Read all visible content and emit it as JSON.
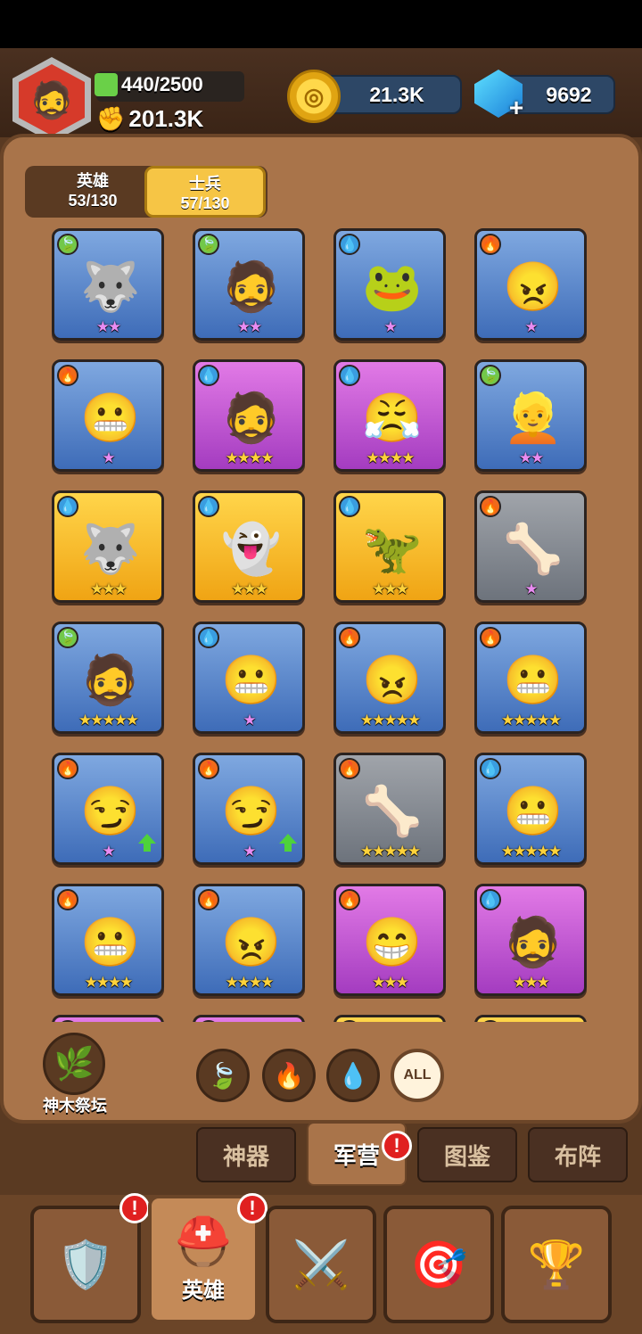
{
  "player": {
    "stamina": "440/2500",
    "power": "201.3K",
    "coins": "21.3K",
    "gems": "9692"
  },
  "toggle": {
    "heroes_label": "英雄",
    "heroes_count": "53/130",
    "soldiers_label": "士兵",
    "soldiers_count": "57/130"
  },
  "cards": [
    {
      "element": "leaf",
      "bg": "blue",
      "stars": 2,
      "star_color": "pink",
      "icon": "🐺",
      "upgrade": false
    },
    {
      "element": "leaf",
      "bg": "blue",
      "stars": 2,
      "star_color": "pink",
      "icon": "🧔",
      "upgrade": false
    },
    {
      "element": "water",
      "bg": "blue",
      "stars": 1,
      "star_color": "pink",
      "icon": "🐸",
      "upgrade": false
    },
    {
      "element": "fire",
      "bg": "blue",
      "stars": 1,
      "star_color": "pink",
      "icon": "😠",
      "upgrade": false
    },
    {
      "element": "fire",
      "bg": "blue",
      "stars": 1,
      "star_color": "pink",
      "icon": "😬",
      "upgrade": false
    },
    {
      "element": "water",
      "bg": "purple",
      "stars": 4,
      "star_color": "gold",
      "icon": "🧔",
      "upgrade": false
    },
    {
      "element": "water",
      "bg": "purple",
      "stars": 4,
      "star_color": "gold",
      "icon": "😤",
      "upgrade": false
    },
    {
      "element": "leaf",
      "bg": "blue",
      "stars": 2,
      "star_color": "pink",
      "icon": "👱",
      "upgrade": false
    },
    {
      "element": "water",
      "bg": "yellow",
      "stars": 3,
      "star_color": "gold",
      "icon": "🐺",
      "upgrade": false
    },
    {
      "element": "water",
      "bg": "yellow",
      "stars": 3,
      "star_color": "gold",
      "icon": "👻",
      "upgrade": false
    },
    {
      "element": "water",
      "bg": "yellow",
      "stars": 3,
      "star_color": "gold",
      "icon": "🦖",
      "upgrade": false
    },
    {
      "element": "fire",
      "bg": "grey",
      "stars": 1,
      "star_color": "pink",
      "icon": "🦴",
      "upgrade": false
    },
    {
      "element": "leaf",
      "bg": "blue",
      "stars": 5,
      "star_color": "gold",
      "icon": "🧔",
      "upgrade": false
    },
    {
      "element": "water",
      "bg": "blue",
      "stars": 1,
      "star_color": "pink",
      "icon": "😬",
      "upgrade": false
    },
    {
      "element": "fire",
      "bg": "blue",
      "stars": 5,
      "star_color": "gold",
      "icon": "😠",
      "upgrade": false
    },
    {
      "element": "fire",
      "bg": "blue",
      "stars": 5,
      "star_color": "gold",
      "icon": "😬",
      "upgrade": false
    },
    {
      "element": "fire",
      "bg": "blue",
      "stars": 1,
      "star_color": "pink",
      "icon": "😏",
      "upgrade": true
    },
    {
      "element": "fire",
      "bg": "blue",
      "stars": 1,
      "star_color": "pink",
      "icon": "😏",
      "upgrade": true
    },
    {
      "element": "fire",
      "bg": "grey",
      "stars": 5,
      "star_color": "gold",
      "icon": "🦴",
      "upgrade": false
    },
    {
      "element": "water",
      "bg": "blue",
      "stars": 5,
      "star_color": "gold",
      "icon": "😬",
      "upgrade": false
    },
    {
      "element": "fire",
      "bg": "blue",
      "stars": 4,
      "star_color": "gold",
      "icon": "😬",
      "upgrade": false
    },
    {
      "element": "fire",
      "bg": "blue",
      "stars": 4,
      "star_color": "gold",
      "icon": "😠",
      "upgrade": false
    },
    {
      "element": "fire",
      "bg": "purple",
      "stars": 3,
      "star_color": "gold",
      "icon": "😁",
      "upgrade": false
    },
    {
      "element": "water",
      "bg": "purple",
      "stars": 3,
      "star_color": "gold",
      "icon": "🧔",
      "upgrade": false
    },
    {
      "element": "leaf",
      "bg": "purple",
      "stars": 0,
      "star_color": "gold",
      "icon": "",
      "upgrade": false
    },
    {
      "element": "fire",
      "bg": "purple",
      "stars": 0,
      "star_color": "gold",
      "icon": "",
      "upgrade": false
    },
    {
      "element": "fire",
      "bg": "yellow",
      "stars": 0,
      "star_color": "gold",
      "icon": "",
      "upgrade": false
    },
    {
      "element": "water",
      "bg": "yellow",
      "stars": 0,
      "star_color": "gold",
      "icon": "",
      "upgrade": false
    }
  ],
  "shrine": {
    "label": "神木祭坛",
    "icon": "tree-icon"
  },
  "filters": {
    "all_label": "ALL"
  },
  "subtabs": {
    "artifacts": "神器",
    "barracks": "军营",
    "codex": "图鉴",
    "formation": "布阵"
  },
  "nav": {
    "heroes_label": "英雄"
  },
  "colors": {
    "panel": "#a9744a",
    "active_toggle": "#f6c545",
    "badge": "#e02020"
  }
}
